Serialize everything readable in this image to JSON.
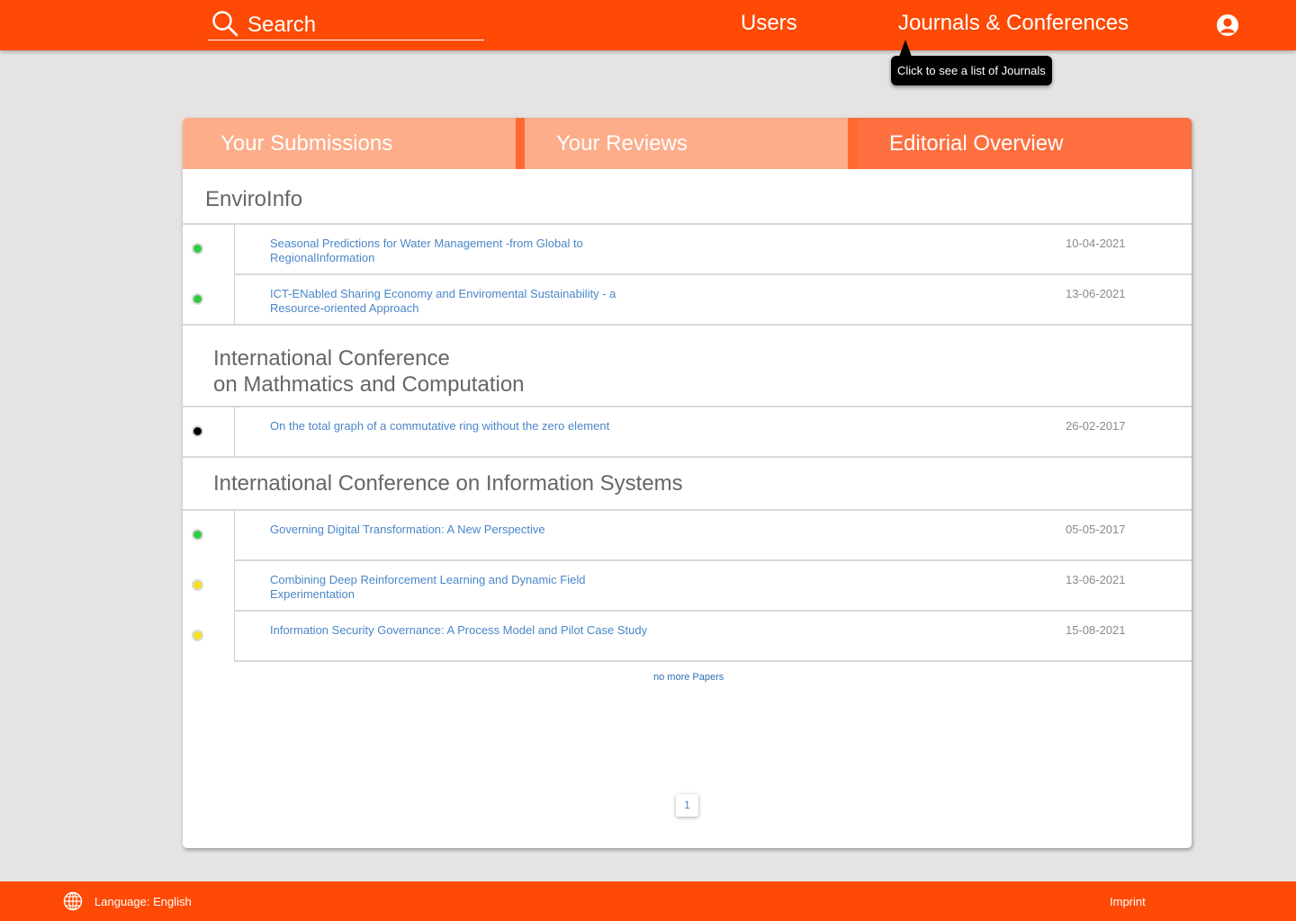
{
  "header": {
    "search_placeholder": "Search",
    "nav": {
      "users": "Users",
      "journals": "Journals & Conferences"
    },
    "tooltip": "Click to see a list of Journals",
    "icons": {
      "search": "search-icon",
      "user": "user-icon"
    }
  },
  "tabs": [
    {
      "label": "Your Submissions",
      "active": false
    },
    {
      "label": "Your Reviews",
      "active": false
    },
    {
      "label": "Editorial Overview",
      "active": true
    }
  ],
  "groups": [
    {
      "title": "EnviroInfo",
      "papers": [
        {
          "title": "Seasonal Predictions for Water Management -from Global to RegionalInformation",
          "date": "10-04-2021",
          "status": "green"
        },
        {
          "title": "ICT-ENabled Sharing Economy and Enviromental Sustainability - a Resource-oriented Approach",
          "date": "13-06-2021",
          "status": "green"
        }
      ]
    },
    {
      "title": "International Conference\non Mathmatics and Computation",
      "papers": [
        {
          "title": "On the total graph of a commutative ring without the zero element",
          "date": "26-02-2017",
          "status": "black"
        }
      ]
    },
    {
      "title": "International Conference on Information Systems",
      "papers": [
        {
          "title": "Governing Digital Transformation: A New Perspective",
          "date": "05-05-2017",
          "status": "green"
        },
        {
          "title": "Combining Deep Reinforcement Learning and Dynamic Field Experimentation",
          "date": "13-06-2021",
          "status": "yellow"
        },
        {
          "title": "Information Security Governance: A Process Model and Pilot Case Study",
          "date": "15-08-2021",
          "status": "yellow"
        }
      ]
    }
  ],
  "status_colors": {
    "green": "#2ecc40",
    "yellow": "#f5e01b",
    "black": "#000000"
  },
  "list_footer": "no more Papers",
  "pagination": {
    "current_page": "1"
  },
  "footer": {
    "language": "Language: English",
    "imprint": "Imprint",
    "globe_icon": "globe-icon"
  }
}
